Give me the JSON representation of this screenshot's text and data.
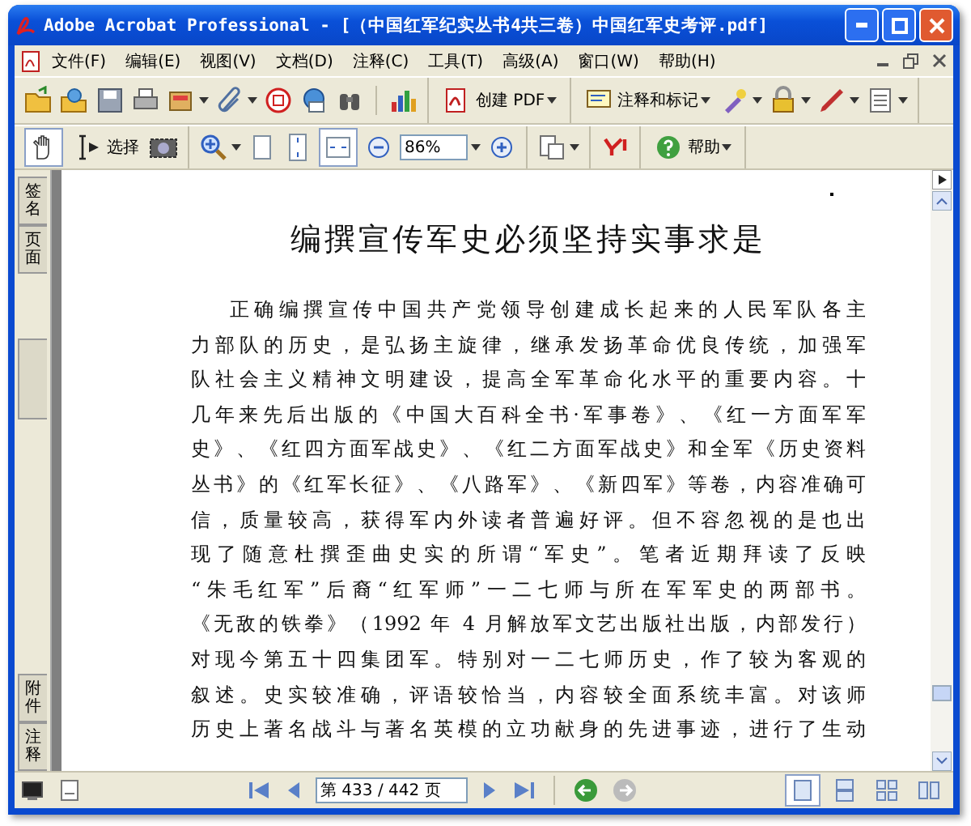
{
  "window": {
    "title": "Adobe Acrobat Professional - [（中国红军纪实丛书4共三卷）中国红军史考评.pdf]"
  },
  "menu": [
    "文件(F)",
    "编辑(E)",
    "视图(V)",
    "文档(D)",
    "注释(C)",
    "工具(T)",
    "高级(A)",
    "窗口(W)",
    "帮助(H)"
  ],
  "toolbar_1": {
    "create_pdf": "创建 PDF",
    "comment_markup": "注释和标记"
  },
  "toolbar_2": {
    "hand_tool_selected": true,
    "select_label": "选择",
    "fit_width_selected": true,
    "zoom_value": "86%",
    "help_label": "帮助"
  },
  "side_tabs": [
    {
      "kind": "text",
      "label": "签名"
    },
    {
      "kind": "text",
      "label": "页面"
    },
    {
      "kind": "blank"
    },
    {
      "kind": "text",
      "label": "附件"
    },
    {
      "kind": "text",
      "label": "注释"
    }
  ],
  "document": {
    "title": "编撰宣传军史必须坚持实事求是",
    "lines": [
      "正确编撰宣传中国共产党领导创建成长起来的人民军队各主",
      "力部队的历史，是弘扬主旋律，继承发扬革命优良传统，加强军",
      "队社会主义精神文明建设，提高全军革命化水平的重要内容。十",
      "几年来先后出版的《中国大百科全书·军事卷》、《红一方面军军",
      "史》、《红四方面军战史》、《红二方面军战史》和全军《历史资料",
      "丛书》的《红军长征》、《八路军》、《新四军》等卷，内容准确可",
      "信，质量较高，获得军内外读者普遍好评。但不容忽视的是也出",
      "现了随意杜撰歪曲史实的所谓“军史”。笔者近期拜读了反映",
      "“朱毛红军”后裔“红军师”一二七师与所在军军史的两部书。",
      "《无敌的铁拳》（1992 年 4 月解放军文艺出版社出版，内部发行）",
      "对现今第五十四集团军。特别对一二七师历史，作了较为客观的",
      "叙述。史实较准确，评语较恰当，内容较全面系统丰富。对该师",
      "历史上著名战斗与著名英模的立功献身的先进事迹，进行了生动"
    ]
  },
  "status_bar": {
    "page_field": "第 433 / 442 页",
    "page_views": [
      {
        "selected": true
      },
      {
        "selected": false
      },
      {
        "selected": false
      },
      {
        "selected": false
      }
    ]
  }
}
